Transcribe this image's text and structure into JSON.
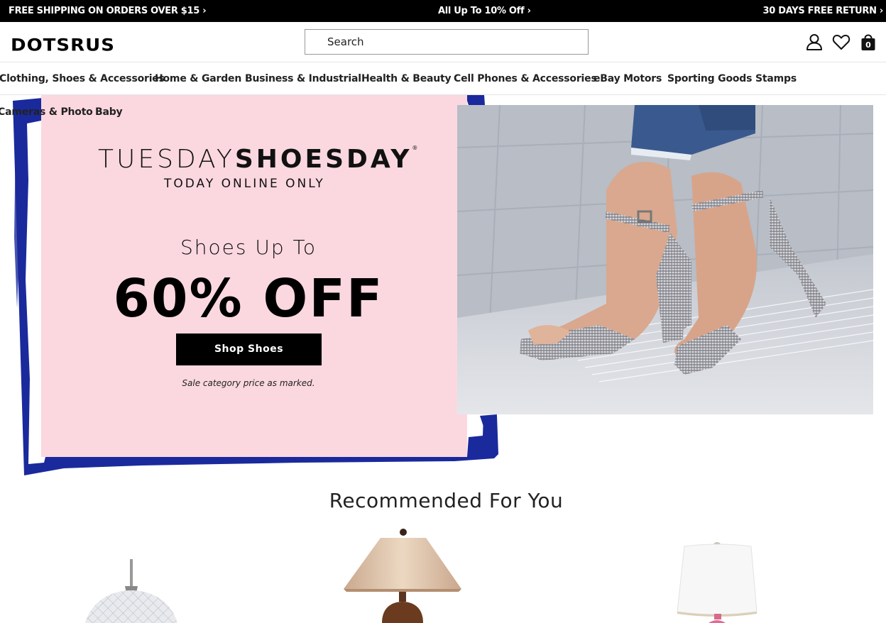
{
  "promo_bar": {
    "left": "FREE SHIPPING ON ORDERS OVER $15 ›",
    "center": "All Up To 10% Off ›",
    "right": "30 DAYS FREE RETURN ›"
  },
  "header": {
    "logo": "DOTSRUS",
    "search": {
      "value": "Search"
    },
    "icons": [
      "account-icon",
      "heart-icon",
      "bag-icon"
    ],
    "bag_count": "0"
  },
  "nav": {
    "items": [
      "Clothing, Shoes & Accessories",
      "Home & Garden",
      "Business & Industrial",
      "Health & Beauty",
      "Cell Phones & Accessories",
      "eBay Motors",
      "Sporting Goods",
      "Stamps",
      "Cameras & Photo",
      "Baby"
    ]
  },
  "hero": {
    "title_light": "TUESDAY",
    "title_bold": "SHOESDAY",
    "title_mark": "®",
    "subtitle": "TODAY ONLINE ONLY",
    "lead": "Shoes Up To",
    "discount": "60% OFF",
    "cta": "Shop Shoes",
    "disclaimer": "Sale category price as marked.",
    "colors": {
      "panel": "#fbd8e0",
      "brush": "#1a2a9c",
      "cta": "#000000"
    }
  },
  "recommended": {
    "title": "Recommended For You",
    "products": [
      "pendant-lamp-image",
      "table-lamp-image",
      "white-shade-lamp-image"
    ]
  }
}
